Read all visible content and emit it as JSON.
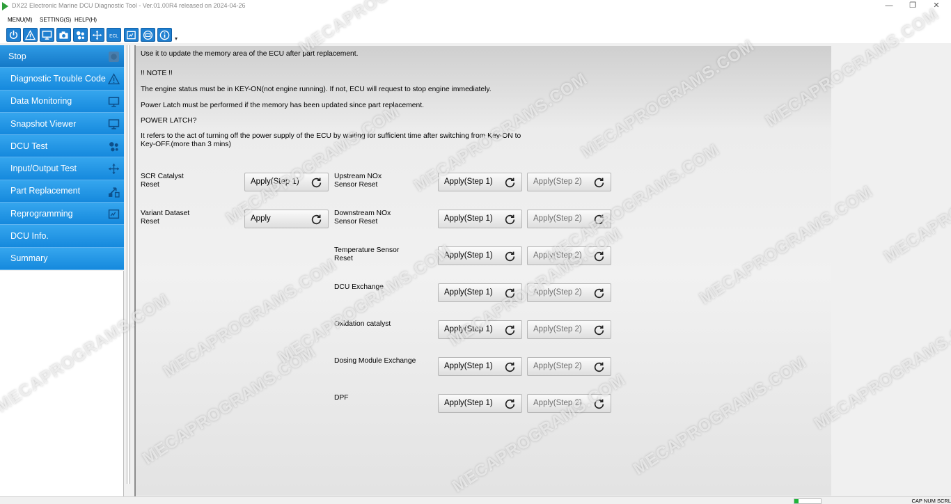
{
  "window": {
    "title": "DX22 Electronic Marine DCU Diagnostic Tool - Ver.01.00R4 released on 2024-04-26",
    "controls": [
      "—",
      "❐",
      "✕"
    ]
  },
  "menu": [
    "MENU(M)",
    "SETTING(S)",
    "HELP(H)"
  ],
  "toolbar": {
    "icons": [
      "power-icon",
      "warning-icon",
      "monitor-icon",
      "camera-icon",
      "dcu-test-icon",
      "io-test-icon",
      "ecl-icon",
      "reprogram-icon",
      "dcu-info-icon",
      "info-icon"
    ],
    "ecl_text": "ECL",
    "more": "▾"
  },
  "sidebar": {
    "items": [
      {
        "label": "Stop",
        "icon": "stop-icon"
      },
      {
        "label": "Diagnostic Trouble Code",
        "icon": "warning-icon"
      },
      {
        "label": "Data Monitoring",
        "icon": "monitor-icon"
      },
      {
        "label": "Snapshot Viewer",
        "icon": "monitor-icon"
      },
      {
        "label": "DCU Test",
        "icon": "gear-group-icon"
      },
      {
        "label": "Input/Output Test",
        "icon": "arrows-icon"
      },
      {
        "label": "Part Replacement",
        "icon": "swap-icon"
      },
      {
        "label": "Reprogramming",
        "icon": "reprogram-icon"
      },
      {
        "label": "DCU Info.",
        "icon": ""
      },
      {
        "label": "Summary",
        "icon": ""
      }
    ]
  },
  "content": {
    "intro": "Use it to update the memory area of the ECU after part replacement.",
    "note_title": "!! NOTE !!",
    "note1": "The engine status must be in KEY-ON(not engine running). If not, ECU will request to stop engine immediately.",
    "note2": "Power Latch must be performed if the memory has been updated since part replacement.",
    "power_latch_title": "POWER LATCH?",
    "power_latch_line1": "It refers to the act of turning off the power supply of the ECU by waiting for sufficient time after switching from Key-ON to",
    "power_latch_line2": "Key-OFF.(more than 3 mins)"
  },
  "resets": {
    "left": [
      {
        "label_line1": "SCR Catalyst",
        "label_line2": "Reset",
        "button": "Apply(Step 1)"
      },
      {
        "label_line1": "Variant Dataset",
        "label_line2": "Reset",
        "button": "Apply"
      }
    ],
    "right": [
      {
        "label_line1": "Upstream NOx",
        "label_line2": "Sensor Reset",
        "step1": "Apply(Step 1)",
        "step2": "Apply(Step 2)"
      },
      {
        "label_line1": "Downstream NOx",
        "label_line2": "Sensor Reset",
        "step1": "Apply(Step 1)",
        "step2": "Apply(Step 2)"
      },
      {
        "label_line1": "Temperature Sensor",
        "label_line2": "Reset",
        "step1": "Apply(Step 1)",
        "step2": "Apply(Step 2)"
      },
      {
        "label_line1": "DCU Exchange",
        "label_line2": "",
        "step1": "Apply(Step 1)",
        "step2": "Apply(Step 2)"
      },
      {
        "label_line1": "Oxidation catalyst",
        "label_line2": "",
        "step1": "Apply(Step 1)",
        "step2": "Apply(Step 2)"
      },
      {
        "label_line1": "Dosing Module Exchange",
        "label_line2": "",
        "step1": "Apply(Step 1)",
        "step2": "Apply(Step 2)"
      },
      {
        "label_line1": "DPF",
        "label_line2": "",
        "step1": "Apply(Step 1)",
        "step2": "Apply(Step 2)"
      }
    ]
  },
  "statusbar": {
    "progress": 0.15,
    "keys": "CAP  NUM  SCRL"
  },
  "colors": {
    "sidebar_blue": "#1f8fe0",
    "toolbar_blue": "#1e7fd0",
    "progress_green": "#1fb53a"
  },
  "watermark": "MECAPROGRAMS.COM"
}
